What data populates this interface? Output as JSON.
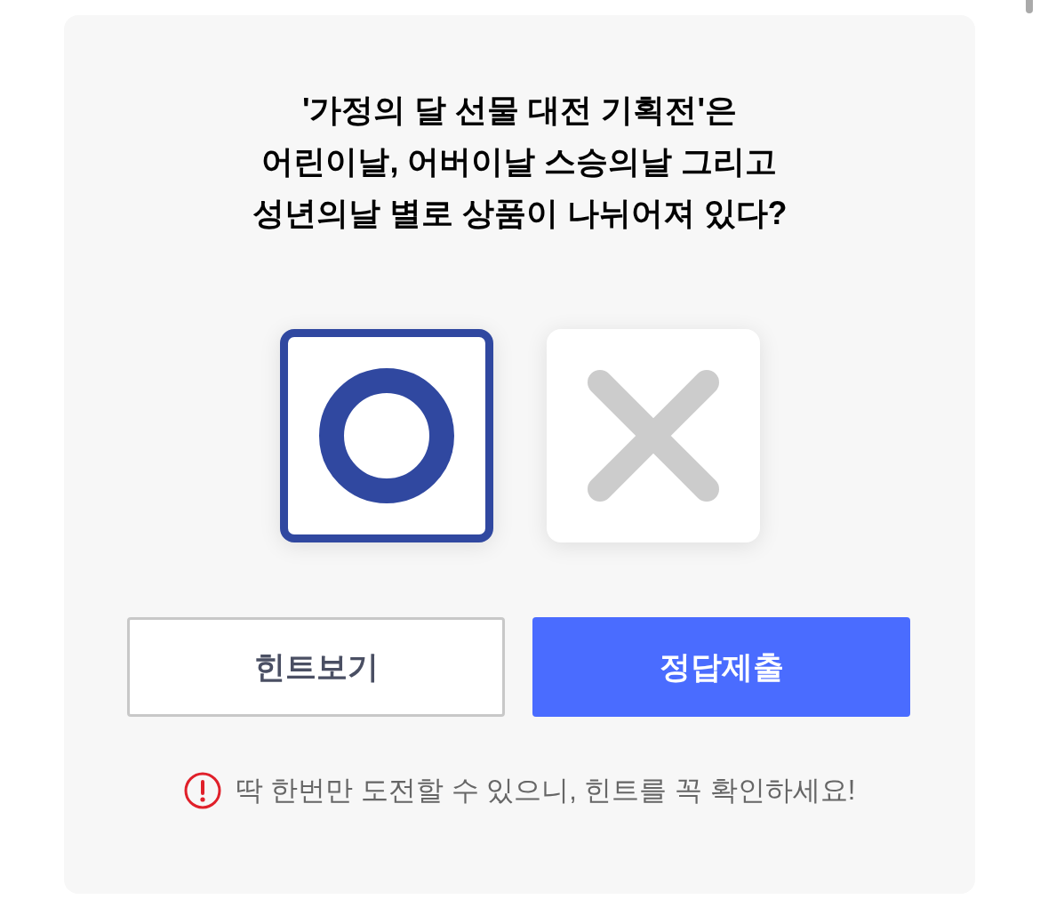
{
  "question": {
    "lines": [
      "'가정의 달 선물 대전 기획전'은",
      "어린이날, 어버이날 스승의날 그리고",
      "성년의날 별로 상품이 나뉘어져 있다?"
    ]
  },
  "options": [
    {
      "kind": "o",
      "selected": true
    },
    {
      "kind": "x",
      "selected": false
    }
  ],
  "buttons": [
    {
      "kind": "hint",
      "label": "힌트보기"
    },
    {
      "kind": "submit",
      "label": "정답제출"
    }
  ],
  "notice": {
    "text": "딱 한번만 도전할 수 있으니, 힌트를 꼭 확인하세요!"
  }
}
